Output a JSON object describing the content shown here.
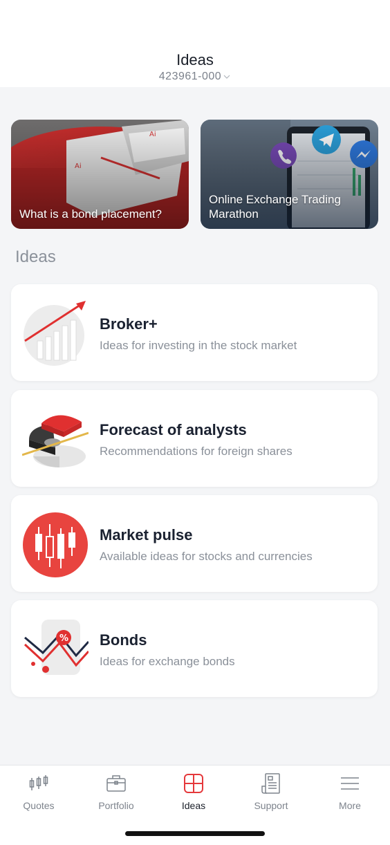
{
  "header": {
    "title": "Ideas",
    "account": "423961-000"
  },
  "promos": [
    {
      "caption": "What is a bond placement?"
    },
    {
      "caption": "Online Exchange Trading Marathon"
    }
  ],
  "section": {
    "title": "Ideas"
  },
  "cards": [
    {
      "title": "Broker+",
      "description": "Ideas for investing in the stock market",
      "icon": "rising-bars-chart-icon"
    },
    {
      "title": "Forecast of analysts",
      "description": "Recommendations for foreign shares",
      "icon": "pie-chart-3d-icon"
    },
    {
      "title": "Market pulse",
      "description": "Available ideas for stocks and currencies",
      "icon": "candlestick-chart-icon"
    },
    {
      "title": "Bonds",
      "description": "Ideas for exchange bonds",
      "icon": "percent-chart-icon"
    }
  ],
  "tabbar": {
    "items": [
      {
        "label": "Quotes",
        "icon": "candlestick-icon",
        "active": false
      },
      {
        "label": "Portfolio",
        "icon": "briefcase-icon",
        "active": false
      },
      {
        "label": "Ideas",
        "icon": "grid-icon",
        "active": true
      },
      {
        "label": "Support",
        "icon": "document-icon",
        "active": false
      },
      {
        "label": "More",
        "icon": "menu-icon",
        "active": false
      }
    ]
  },
  "colors": {
    "accent": "#e5383b",
    "background": "#f4f5f7",
    "card": "#ffffff",
    "text_primary": "#1a2130",
    "text_secondary": "#8a9099"
  }
}
